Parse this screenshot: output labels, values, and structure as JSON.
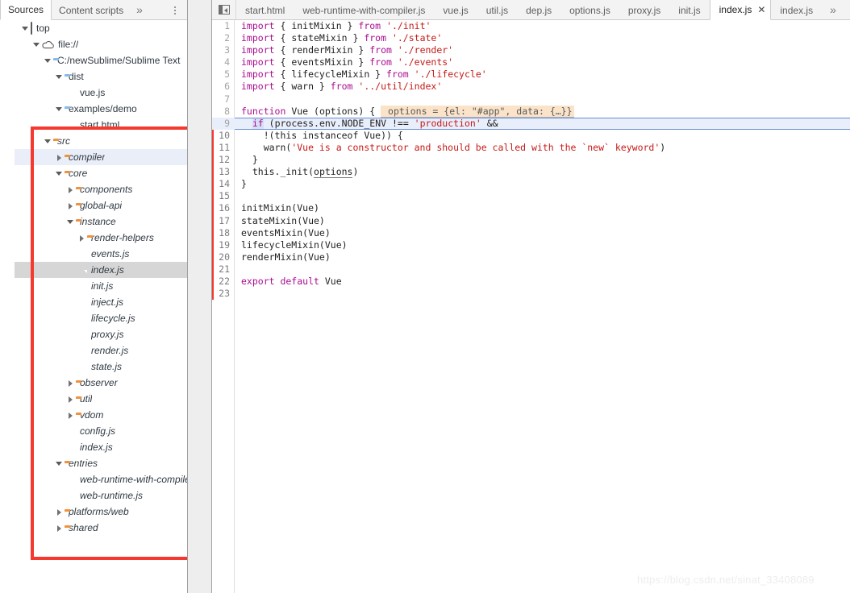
{
  "panel": {
    "tabs": [
      {
        "label": "Sources",
        "active": true
      },
      {
        "label": "Content scripts",
        "active": false
      }
    ],
    "more_icon": "»",
    "menu_icon": "kebab-menu-icon"
  },
  "tree": {
    "items": [
      {
        "indent": 0,
        "twisty": "open",
        "icon": "frame",
        "label": "top",
        "italic": false,
        "state": "normal"
      },
      {
        "indent": 1,
        "twisty": "open",
        "icon": "cloud",
        "label": "file://",
        "italic": false,
        "state": "normal"
      },
      {
        "indent": 2,
        "twisty": "open",
        "icon": "folder-blue",
        "label": "C:/newSublime/Sublime Text",
        "italic": false,
        "state": "normal"
      },
      {
        "indent": 3,
        "twisty": "open",
        "icon": "folder-blue",
        "label": "dist",
        "italic": false,
        "state": "normal"
      },
      {
        "indent": 4,
        "twisty": "none",
        "icon": "file-js",
        "label": "vue.js",
        "italic": false,
        "state": "normal"
      },
      {
        "indent": 3,
        "twisty": "open",
        "icon": "folder-blue",
        "label": "examples/demo",
        "italic": false,
        "state": "normal"
      },
      {
        "indent": 4,
        "twisty": "none",
        "icon": "file-html",
        "label": "start.html",
        "italic": false,
        "state": "normal"
      },
      {
        "indent": 2,
        "twisty": "open",
        "icon": "folder-orange",
        "label": "src",
        "italic": true,
        "state": "normal"
      },
      {
        "indent": 3,
        "twisty": "closed",
        "icon": "folder-orange",
        "label": "compiler",
        "italic": true,
        "state": "hover"
      },
      {
        "indent": 3,
        "twisty": "open",
        "icon": "folder-orange",
        "label": "core",
        "italic": true,
        "state": "normal"
      },
      {
        "indent": 4,
        "twisty": "closed",
        "icon": "folder-orange",
        "label": "components",
        "italic": true,
        "state": "normal"
      },
      {
        "indent": 4,
        "twisty": "closed",
        "icon": "folder-orange",
        "label": "global-api",
        "italic": true,
        "state": "normal"
      },
      {
        "indent": 4,
        "twisty": "open",
        "icon": "folder-orange",
        "label": "instance",
        "italic": true,
        "state": "normal"
      },
      {
        "indent": 5,
        "twisty": "closed",
        "icon": "folder-orange",
        "label": "render-helpers",
        "italic": true,
        "state": "normal"
      },
      {
        "indent": 5,
        "twisty": "none",
        "icon": "file-js",
        "label": "events.js",
        "italic": true,
        "state": "normal"
      },
      {
        "indent": 5,
        "twisty": "none",
        "icon": "file-js",
        "label": "index.js",
        "italic": true,
        "state": "selected"
      },
      {
        "indent": 5,
        "twisty": "none",
        "icon": "file-js",
        "label": "init.js",
        "italic": true,
        "state": "normal"
      },
      {
        "indent": 5,
        "twisty": "none",
        "icon": "file-js",
        "label": "inject.js",
        "italic": true,
        "state": "normal"
      },
      {
        "indent": 5,
        "twisty": "none",
        "icon": "file-js",
        "label": "lifecycle.js",
        "italic": true,
        "state": "normal"
      },
      {
        "indent": 5,
        "twisty": "none",
        "icon": "file-js",
        "label": "proxy.js",
        "italic": true,
        "state": "normal"
      },
      {
        "indent": 5,
        "twisty": "none",
        "icon": "file-js",
        "label": "render.js",
        "italic": true,
        "state": "normal"
      },
      {
        "indent": 5,
        "twisty": "none",
        "icon": "file-js",
        "label": "state.js",
        "italic": true,
        "state": "normal"
      },
      {
        "indent": 4,
        "twisty": "closed",
        "icon": "folder-orange",
        "label": "observer",
        "italic": true,
        "state": "normal"
      },
      {
        "indent": 4,
        "twisty": "closed",
        "icon": "folder-orange",
        "label": "util",
        "italic": true,
        "state": "normal"
      },
      {
        "indent": 4,
        "twisty": "closed",
        "icon": "folder-orange",
        "label": "vdom",
        "italic": true,
        "state": "normal"
      },
      {
        "indent": 4,
        "twisty": "none",
        "icon": "file-js",
        "label": "config.js",
        "italic": true,
        "state": "normal"
      },
      {
        "indent": 4,
        "twisty": "none",
        "icon": "file-js",
        "label": "index.js",
        "italic": true,
        "state": "normal"
      },
      {
        "indent": 3,
        "twisty": "open",
        "icon": "folder-orange",
        "label": "entries",
        "italic": true,
        "state": "normal"
      },
      {
        "indent": 4,
        "twisty": "none",
        "icon": "file-js",
        "label": "web-runtime-with-compiler.js",
        "italic": true,
        "state": "normal"
      },
      {
        "indent": 4,
        "twisty": "none",
        "icon": "file-js",
        "label": "web-runtime.js",
        "italic": true,
        "state": "normal"
      },
      {
        "indent": 3,
        "twisty": "closed",
        "icon": "folder-orange",
        "label": "platforms/web",
        "italic": true,
        "state": "normal"
      },
      {
        "indent": 3,
        "twisty": "closed",
        "icon": "folder-orange",
        "label": "shared",
        "italic": true,
        "state": "normal"
      }
    ]
  },
  "editor": {
    "nav_icon": "show-navigator-icon",
    "tabs": [
      {
        "label": "start.html",
        "active": false,
        "closable": false
      },
      {
        "label": "web-runtime-with-compiler.js",
        "active": false,
        "closable": false
      },
      {
        "label": "vue.js",
        "active": false,
        "closable": false
      },
      {
        "label": "util.js",
        "active": false,
        "closable": false
      },
      {
        "label": "dep.js",
        "active": false,
        "closable": false
      },
      {
        "label": "options.js",
        "active": false,
        "closable": false
      },
      {
        "label": "proxy.js",
        "active": false,
        "closable": false
      },
      {
        "label": "init.js",
        "active": false,
        "closable": false
      },
      {
        "label": "index.js",
        "active": true,
        "closable": true,
        "close_icon": "✕"
      },
      {
        "label": "index.js",
        "active": false,
        "closable": false
      }
    ],
    "more_icon": "»"
  },
  "code": {
    "lines": [
      {
        "n": "1",
        "segments": [
          {
            "t": "import ",
            "c": "kw"
          },
          {
            "t": "{ initMixin } ",
            "c": "plain"
          },
          {
            "t": "from ",
            "c": "kw"
          },
          {
            "t": "'./init'",
            "c": "str"
          }
        ]
      },
      {
        "n": "2",
        "segments": [
          {
            "t": "import ",
            "c": "kw"
          },
          {
            "t": "{ stateMixin } ",
            "c": "plain"
          },
          {
            "t": "from ",
            "c": "kw"
          },
          {
            "t": "'./state'",
            "c": "str"
          }
        ]
      },
      {
        "n": "3",
        "segments": [
          {
            "t": "import ",
            "c": "kw"
          },
          {
            "t": "{ renderMixin } ",
            "c": "plain"
          },
          {
            "t": "from ",
            "c": "kw"
          },
          {
            "t": "'./render'",
            "c": "str"
          }
        ]
      },
      {
        "n": "4",
        "segments": [
          {
            "t": "import ",
            "c": "kw"
          },
          {
            "t": "{ eventsMixin } ",
            "c": "plain"
          },
          {
            "t": "from ",
            "c": "kw"
          },
          {
            "t": "'./events'",
            "c": "str"
          }
        ]
      },
      {
        "n": "5",
        "segments": [
          {
            "t": "import ",
            "c": "kw"
          },
          {
            "t": "{ lifecycleMixin } ",
            "c": "plain"
          },
          {
            "t": "from ",
            "c": "kw"
          },
          {
            "t": "'./lifecycle'",
            "c": "str"
          }
        ]
      },
      {
        "n": "6",
        "segments": [
          {
            "t": "import ",
            "c": "kw"
          },
          {
            "t": "{ warn } ",
            "c": "plain"
          },
          {
            "t": "from ",
            "c": "kw"
          },
          {
            "t": "'../util/index'",
            "c": "str"
          }
        ]
      },
      {
        "n": "7",
        "segments": []
      },
      {
        "n": "8",
        "segments": [
          {
            "t": "function ",
            "c": "kw"
          },
          {
            "t": "Vue ",
            "c": "plain"
          },
          {
            "t": "(options) { ",
            "c": "plain"
          }
        ],
        "hint": " options = {el: \"#app\", data: {…}}"
      },
      {
        "n": "9",
        "segments": [
          {
            "t": "  ",
            "c": "plain"
          },
          {
            "t": "if",
            "c": "hl-if"
          },
          {
            "t": " (process.env.NODE_ENV ",
            "c": "plain"
          },
          {
            "t": "!== ",
            "c": "plain"
          },
          {
            "t": "'production'",
            "c": "str"
          },
          {
            "t": " &&",
            "c": "plain"
          }
        ],
        "paused": true
      },
      {
        "n": "10",
        "segments": [
          {
            "t": "    !(this instanceof Vue)) {",
            "c": "plain"
          }
        ],
        "exec": true
      },
      {
        "n": "11",
        "segments": [
          {
            "t": "    warn(",
            "c": "plain"
          },
          {
            "t": "'Vue is a constructor and should be called with the `new` keyword'",
            "c": "str"
          },
          {
            "t": ")",
            "c": "plain"
          }
        ],
        "exec": true
      },
      {
        "n": "12",
        "segments": [
          {
            "t": "  }",
            "c": "plain"
          }
        ],
        "exec": true
      },
      {
        "n": "13",
        "segments": [
          {
            "t": "  this._init(",
            "c": "plain"
          },
          {
            "t": "options",
            "c": "underline-sel"
          },
          {
            "t": ")",
            "c": "plain"
          }
        ],
        "exec": true
      },
      {
        "n": "14",
        "segments": [
          {
            "t": "}",
            "c": "plain"
          }
        ],
        "exec": true
      },
      {
        "n": "15",
        "segments": [],
        "exec": true
      },
      {
        "n": "16",
        "segments": [
          {
            "t": "initMixin(Vue)",
            "c": "plain"
          }
        ],
        "exec": true
      },
      {
        "n": "17",
        "segments": [
          {
            "t": "stateMixin(Vue)",
            "c": "plain"
          }
        ],
        "exec": true
      },
      {
        "n": "18",
        "segments": [
          {
            "t": "eventsMixin(Vue)",
            "c": "plain"
          }
        ],
        "exec": true
      },
      {
        "n": "19",
        "segments": [
          {
            "t": "lifecycleMixin(Vue)",
            "c": "plain"
          }
        ],
        "exec": true
      },
      {
        "n": "20",
        "segments": [
          {
            "t": "renderMixin(Vue)",
            "c": "plain"
          }
        ],
        "exec": true
      },
      {
        "n": "21",
        "segments": [],
        "exec": true
      },
      {
        "n": "22",
        "segments": [
          {
            "t": "export default ",
            "c": "kw"
          },
          {
            "t": "Vue",
            "c": "plain"
          }
        ],
        "exec": true
      },
      {
        "n": "23",
        "segments": [],
        "exec": true
      }
    ]
  },
  "watermark": {
    "text": "https://blog.csdn.net/sinat_33408089"
  },
  "colors": {
    "annotation_red": "#f6392f",
    "folder_blue": "#89b9e8",
    "folder_orange": "#f0923c",
    "file_js_yellow": "#e6cd63",
    "selection_gray": "#d6d6d6",
    "hover_blue": "#eaeef9",
    "paused_line": "#e9eefb",
    "hint_bg": "#fae3c8",
    "keyword_purple": "#aa0d91",
    "string_red": "#c41a16"
  }
}
